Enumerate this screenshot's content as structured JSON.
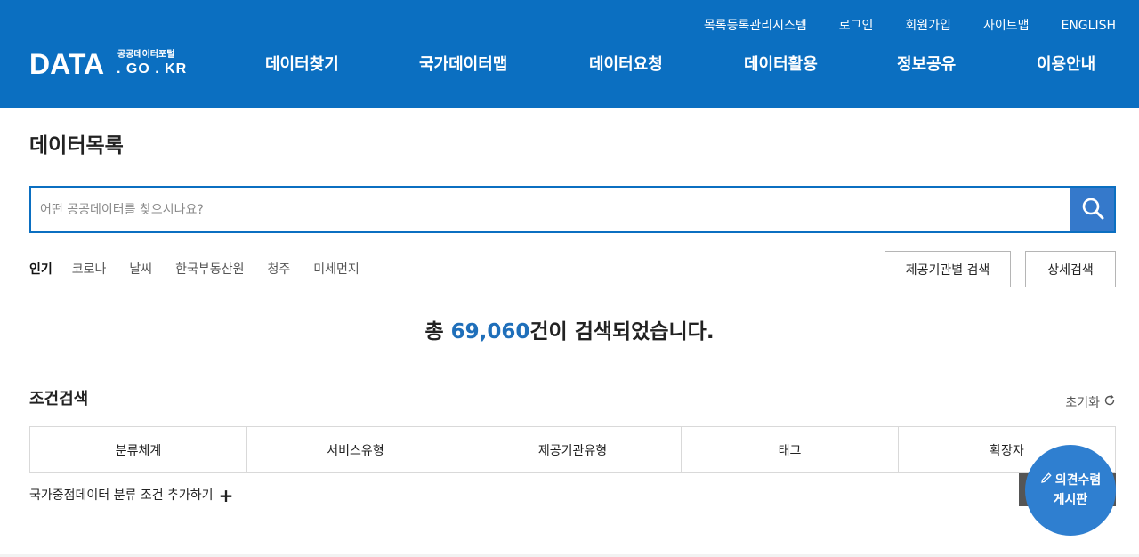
{
  "header": {
    "util_links": [
      "목록등록관리시스템",
      "로그인",
      "회원가입",
      "사이트맵",
      "ENGLISH"
    ],
    "logo": {
      "main": "DATA",
      "small": "공공데이터포털",
      "sub": ". GO . KR"
    },
    "nav": [
      "데이터찾기",
      "국가데이터맵",
      "데이터요청",
      "데이터활용",
      "정보공유",
      "이용안내"
    ],
    "color": "#0b6fc1"
  },
  "main": {
    "title": "데이터목록",
    "search": {
      "placeholder": "어떤 공공데이터를 찾으시나요?",
      "value": "",
      "icon": "search-icon"
    },
    "popular": {
      "label": "인기",
      "keywords": [
        "코로나",
        "날씨",
        "한국부동산원",
        "청주",
        "미세먼지"
      ]
    },
    "buttons": {
      "org_search": "제공기관별 검색",
      "detail_search": "상세검색"
    },
    "result": {
      "prefix": "총 ",
      "count": "69,060",
      "suffix": "건이 검색되었습니다."
    },
    "conditions": {
      "title": "조건검색",
      "reset": "초기화",
      "tabs": [
        "분류체계",
        "서비스유형",
        "제공기관유형",
        "태그",
        "확장자"
      ],
      "add_label": "국가중점데이터 분류 조건 추가하기",
      "add_symbol": "+"
    },
    "feedback": {
      "line1": "의견수렴",
      "line2": "게시판",
      "icon": "pencil-icon"
    }
  }
}
